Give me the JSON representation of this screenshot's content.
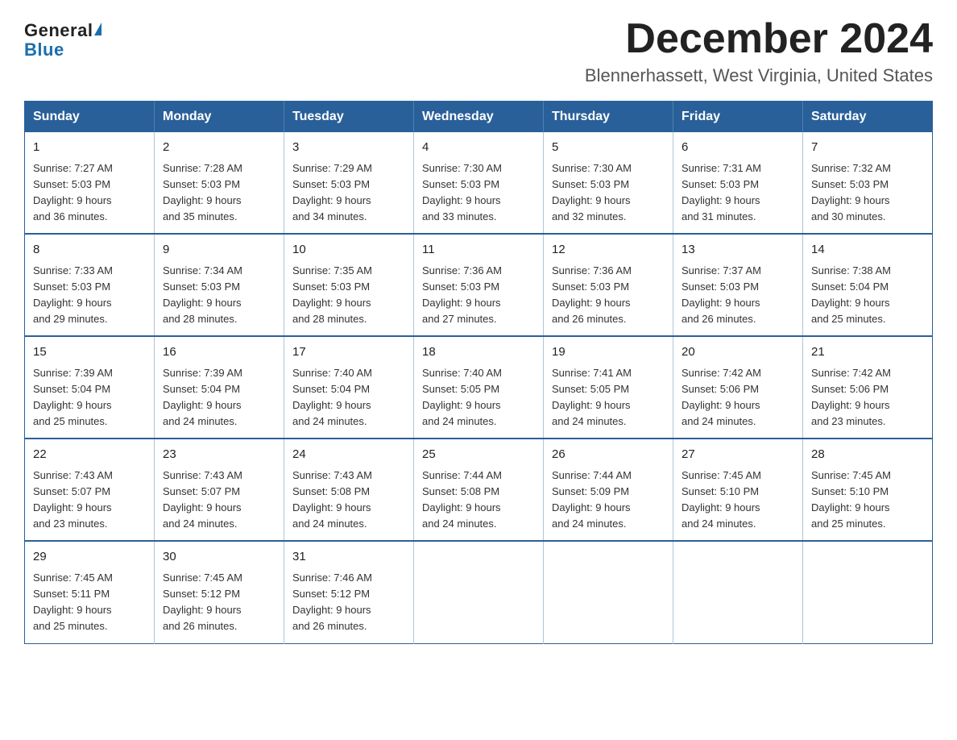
{
  "logo": {
    "general": "General",
    "blue": "Blue"
  },
  "title": "December 2024",
  "subtitle": "Blennerhassett, West Virginia, United States",
  "days_of_week": [
    "Sunday",
    "Monday",
    "Tuesday",
    "Wednesday",
    "Thursday",
    "Friday",
    "Saturday"
  ],
  "weeks": [
    [
      {
        "day": "1",
        "sunrise": "7:27 AM",
        "sunset": "5:03 PM",
        "daylight": "9 hours and 36 minutes."
      },
      {
        "day": "2",
        "sunrise": "7:28 AM",
        "sunset": "5:03 PM",
        "daylight": "9 hours and 35 minutes."
      },
      {
        "day": "3",
        "sunrise": "7:29 AM",
        "sunset": "5:03 PM",
        "daylight": "9 hours and 34 minutes."
      },
      {
        "day": "4",
        "sunrise": "7:30 AM",
        "sunset": "5:03 PM",
        "daylight": "9 hours and 33 minutes."
      },
      {
        "day": "5",
        "sunrise": "7:30 AM",
        "sunset": "5:03 PM",
        "daylight": "9 hours and 32 minutes."
      },
      {
        "day": "6",
        "sunrise": "7:31 AM",
        "sunset": "5:03 PM",
        "daylight": "9 hours and 31 minutes."
      },
      {
        "day": "7",
        "sunrise": "7:32 AM",
        "sunset": "5:03 PM",
        "daylight": "9 hours and 30 minutes."
      }
    ],
    [
      {
        "day": "8",
        "sunrise": "7:33 AM",
        "sunset": "5:03 PM",
        "daylight": "9 hours and 29 minutes."
      },
      {
        "day": "9",
        "sunrise": "7:34 AM",
        "sunset": "5:03 PM",
        "daylight": "9 hours and 28 minutes."
      },
      {
        "day": "10",
        "sunrise": "7:35 AM",
        "sunset": "5:03 PM",
        "daylight": "9 hours and 28 minutes."
      },
      {
        "day": "11",
        "sunrise": "7:36 AM",
        "sunset": "5:03 PM",
        "daylight": "9 hours and 27 minutes."
      },
      {
        "day": "12",
        "sunrise": "7:36 AM",
        "sunset": "5:03 PM",
        "daylight": "9 hours and 26 minutes."
      },
      {
        "day": "13",
        "sunrise": "7:37 AM",
        "sunset": "5:03 PM",
        "daylight": "9 hours and 26 minutes."
      },
      {
        "day": "14",
        "sunrise": "7:38 AM",
        "sunset": "5:04 PM",
        "daylight": "9 hours and 25 minutes."
      }
    ],
    [
      {
        "day": "15",
        "sunrise": "7:39 AM",
        "sunset": "5:04 PM",
        "daylight": "9 hours and 25 minutes."
      },
      {
        "day": "16",
        "sunrise": "7:39 AM",
        "sunset": "5:04 PM",
        "daylight": "9 hours and 24 minutes."
      },
      {
        "day": "17",
        "sunrise": "7:40 AM",
        "sunset": "5:04 PM",
        "daylight": "9 hours and 24 minutes."
      },
      {
        "day": "18",
        "sunrise": "7:40 AM",
        "sunset": "5:05 PM",
        "daylight": "9 hours and 24 minutes."
      },
      {
        "day": "19",
        "sunrise": "7:41 AM",
        "sunset": "5:05 PM",
        "daylight": "9 hours and 24 minutes."
      },
      {
        "day": "20",
        "sunrise": "7:42 AM",
        "sunset": "5:06 PM",
        "daylight": "9 hours and 24 minutes."
      },
      {
        "day": "21",
        "sunrise": "7:42 AM",
        "sunset": "5:06 PM",
        "daylight": "9 hours and 23 minutes."
      }
    ],
    [
      {
        "day": "22",
        "sunrise": "7:43 AM",
        "sunset": "5:07 PM",
        "daylight": "9 hours and 23 minutes."
      },
      {
        "day": "23",
        "sunrise": "7:43 AM",
        "sunset": "5:07 PM",
        "daylight": "9 hours and 24 minutes."
      },
      {
        "day": "24",
        "sunrise": "7:43 AM",
        "sunset": "5:08 PM",
        "daylight": "9 hours and 24 minutes."
      },
      {
        "day": "25",
        "sunrise": "7:44 AM",
        "sunset": "5:08 PM",
        "daylight": "9 hours and 24 minutes."
      },
      {
        "day": "26",
        "sunrise": "7:44 AM",
        "sunset": "5:09 PM",
        "daylight": "9 hours and 24 minutes."
      },
      {
        "day": "27",
        "sunrise": "7:45 AM",
        "sunset": "5:10 PM",
        "daylight": "9 hours and 24 minutes."
      },
      {
        "day": "28",
        "sunrise": "7:45 AM",
        "sunset": "5:10 PM",
        "daylight": "9 hours and 25 minutes."
      }
    ],
    [
      {
        "day": "29",
        "sunrise": "7:45 AM",
        "sunset": "5:11 PM",
        "daylight": "9 hours and 25 minutes."
      },
      {
        "day": "30",
        "sunrise": "7:45 AM",
        "sunset": "5:12 PM",
        "daylight": "9 hours and 26 minutes."
      },
      {
        "day": "31",
        "sunrise": "7:46 AM",
        "sunset": "5:12 PM",
        "daylight": "9 hours and 26 minutes."
      },
      null,
      null,
      null,
      null
    ]
  ],
  "labels": {
    "sunrise": "Sunrise:",
    "sunset": "Sunset:",
    "daylight": "Daylight:"
  }
}
